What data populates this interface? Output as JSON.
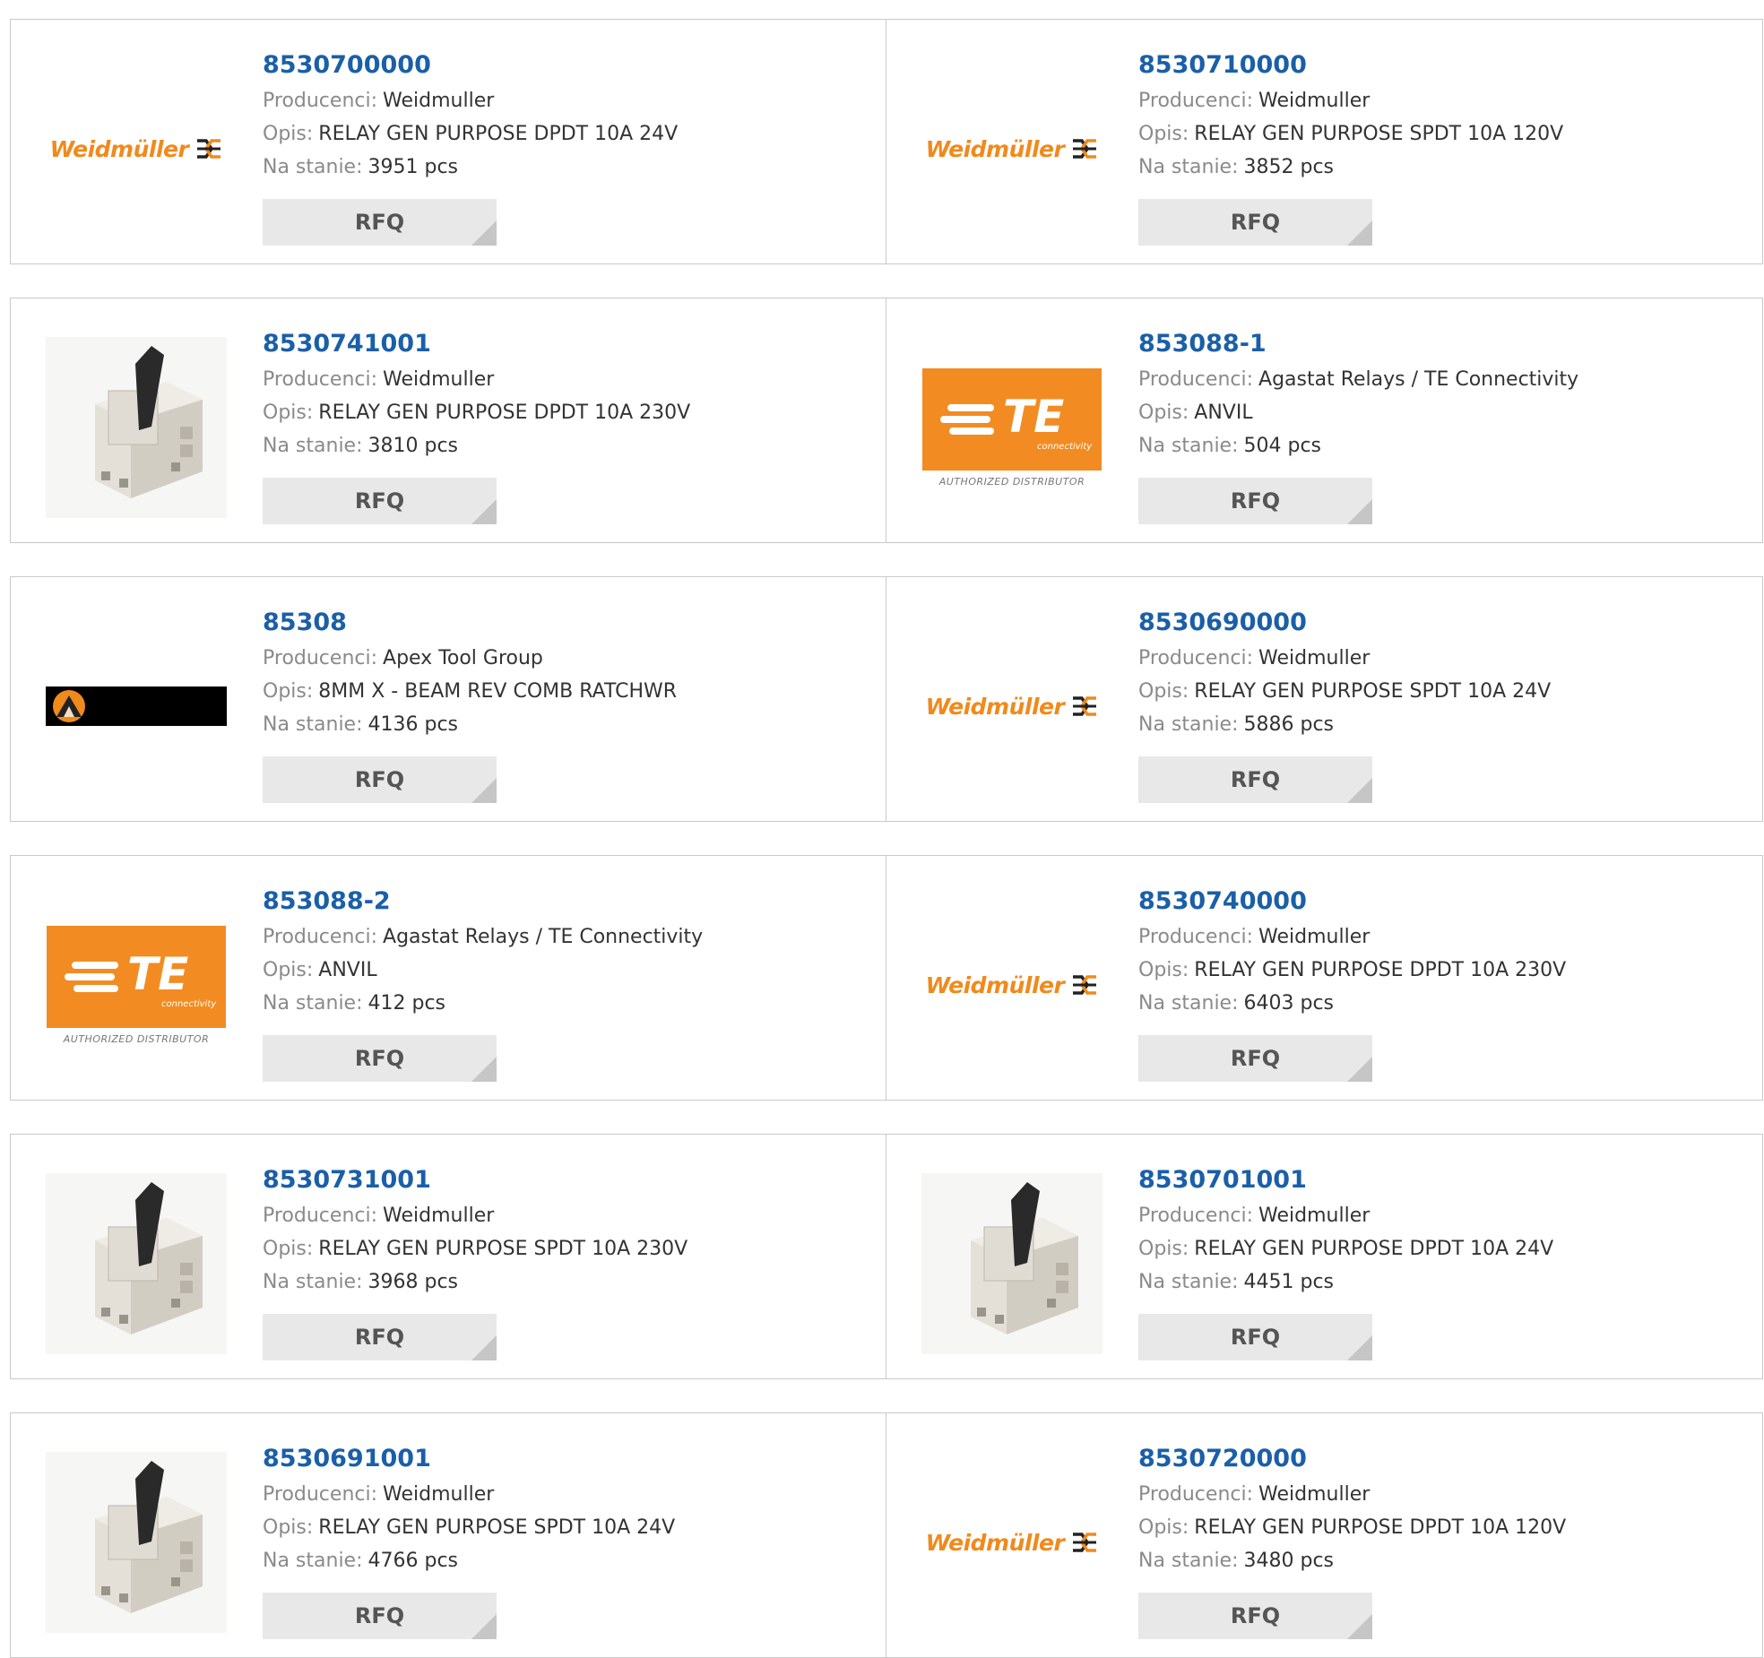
{
  "labels": {
    "manufacturer": "Producenci:",
    "description": "Opis:",
    "stock": "Na stanie:",
    "rfq": "RFQ"
  },
  "colors": {
    "part_link": "#1a5fa8",
    "weidmuller_orange": "#f08a1c",
    "te_orange": "#f28c22"
  },
  "logos": {
    "weidmuller_text": "Weidmüller",
    "te_text": "TE",
    "te_sub": "connectivity",
    "te_distributor": "AUTHORIZED DISTRIBUTOR"
  },
  "products": [
    {
      "part": "8530700000",
      "manufacturer": "Weidmuller",
      "description": "RELAY GEN PURPOSE DPDT 10A 24V",
      "stock": "3951 pcs",
      "image": "weidmuller-logo"
    },
    {
      "part": "8530710000",
      "manufacturer": "Weidmuller",
      "description": "RELAY GEN PURPOSE SPDT 10A 120V",
      "stock": "3852 pcs",
      "image": "weidmuller-logo"
    },
    {
      "part": "8530741001",
      "manufacturer": "Weidmuller",
      "description": "RELAY GEN PURPOSE DPDT 10A 230V",
      "stock": "3810 pcs",
      "image": "relay-photo"
    },
    {
      "part": "853088-1",
      "manufacturer": "Agastat Relays / TE Connectivity",
      "description": "ANVIL",
      "stock": "504 pcs",
      "image": "te-logo"
    },
    {
      "part": "85308",
      "manufacturer": "Apex Tool Group",
      "description": "8MM X - BEAM REV COMB RATCHWR",
      "stock": "4136 pcs",
      "image": "apex-logo"
    },
    {
      "part": "8530690000",
      "manufacturer": "Weidmuller",
      "description": "RELAY GEN PURPOSE SPDT 10A 24V",
      "stock": "5886 pcs",
      "image": "weidmuller-logo"
    },
    {
      "part": "853088-2",
      "manufacturer": "Agastat Relays / TE Connectivity",
      "description": "ANVIL",
      "stock": "412 pcs",
      "image": "te-logo"
    },
    {
      "part": "8530740000",
      "manufacturer": "Weidmuller",
      "description": "RELAY GEN PURPOSE DPDT 10A 230V",
      "stock": "6403 pcs",
      "image": "weidmuller-logo"
    },
    {
      "part": "8530731001",
      "manufacturer": "Weidmuller",
      "description": "RELAY GEN PURPOSE SPDT 10A 230V",
      "stock": "3968 pcs",
      "image": "relay-photo"
    },
    {
      "part": "8530701001",
      "manufacturer": "Weidmuller",
      "description": "RELAY GEN PURPOSE DPDT 10A 24V",
      "stock": "4451 pcs",
      "image": "relay-photo"
    },
    {
      "part": "8530691001",
      "manufacturer": "Weidmuller",
      "description": "RELAY GEN PURPOSE SPDT 10A 24V",
      "stock": "4766 pcs",
      "image": "relay-photo"
    },
    {
      "part": "8530720000",
      "manufacturer": "Weidmuller",
      "description": "RELAY GEN PURPOSE DPDT 10A 120V",
      "stock": "3480 pcs",
      "image": "weidmuller-logo"
    }
  ]
}
